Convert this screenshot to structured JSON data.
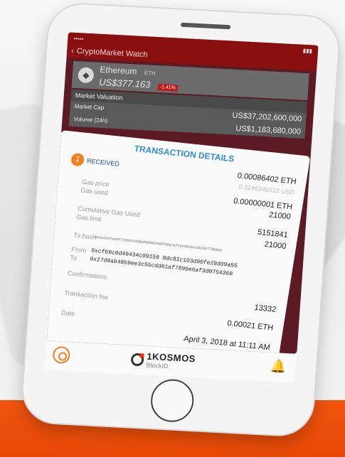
{
  "screen": {
    "nav_title": "CryptoMarket Watch",
    "coin": {
      "name": "Ethereum",
      "symbol": "ETH",
      "price": "US$377.163",
      "change_badge": "-1.41%"
    },
    "market_valuation": {
      "header": "Market Valuation",
      "rows": [
        {
          "label": "Market Cap",
          "value": "US$37,202,600,000"
        },
        {
          "label": "Volume (24h)",
          "value": "US$1,183,680,000"
        }
      ]
    },
    "transaction": {
      "title": "TRANSACTION DETAILS",
      "status": "RECEIVED",
      "amount_eth": "0.00086402 ETH",
      "amount_usd": "0.3246346522 USD",
      "gas_price_label": "Gas price",
      "gas_used_label": "Gas used",
      "gas_price_value": "0.00000001 ETH",
      "gas_used_value": "21000",
      "cumulative_gas_label": "Cumulative Gas Used",
      "gas_limit_label": "Gas limit",
      "cumulative_gas_value": "5151841",
      "gas_limit_value": "21000",
      "tx_hash_label": "Tx hash",
      "tx_hash_value": "0xea1b37be8f7e2b3c44d6a9b8882ee6f86a7afcb4963bec5b202770e6ab",
      "from_label": "From",
      "from_value": "0xcf69c0d49434c09150 8dc81c103d90fe28d09a55",
      "to_label": "To",
      "to_value": "0x27d8ab48b9ee3c55cdd61af7890e6af3d0754360",
      "confirmations_label": "Confirmations",
      "confirmations_value": "13332",
      "tx_fee_label": "Transaction fee",
      "tx_fee_value": "0.00021 ETH",
      "date_label": "Date",
      "date_value": "April 3, 2018 at 11:11 AM"
    }
  },
  "bottom_bar": {
    "logo_text": "1KOSMOS",
    "logo_sub": "BlockID"
  }
}
